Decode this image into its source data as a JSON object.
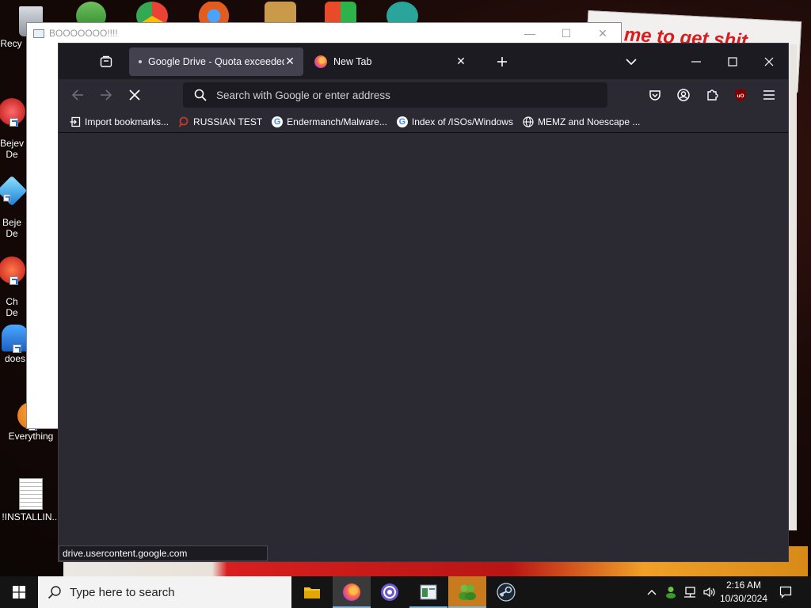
{
  "desktop": {
    "wallpaper_text": "me to get shit",
    "icons": [
      {
        "label": "Recy",
        "name": "recycle-bin"
      },
      {
        "label": "Bejev\nDe",
        "name": "bejeweled-deluxe-1"
      },
      {
        "label": "Beje\nDe",
        "name": "bejeweled-deluxe-2"
      },
      {
        "label": "Ch\nDe",
        "name": "chuzzle-deluxe"
      },
      {
        "label": "does",
        "name": "does-icon"
      },
      {
        "label": "Everything",
        "name": "everything"
      },
      {
        "label": "!INSTALLIN...",
        "name": "installing-file"
      }
    ]
  },
  "bg_window": {
    "title": "BOOOOOOO!!!!"
  },
  "browser": {
    "tabs": [
      {
        "title": "Google Drive - Quota exceeded",
        "active": true,
        "loading": true
      },
      {
        "title": "New Tab",
        "active": false,
        "loading": false
      }
    ],
    "urlbar": {
      "placeholder": "Search with Google or enter address",
      "value": ""
    },
    "bookmarks": [
      {
        "label": "Import bookmarks...",
        "icon": "import-icon"
      },
      {
        "label": "RUSSIAN TEST",
        "icon": "magnifier-icon"
      },
      {
        "label": "Endermanch/Malware...",
        "icon": "google-icon"
      },
      {
        "label": "Index of /ISOs/Windows",
        "icon": "google-icon"
      },
      {
        "label": "MEMZ and Noescape ...",
        "icon": "globe-icon"
      }
    ],
    "status_text": "drive.usercontent.google.com",
    "ublock_badge": "uO"
  },
  "taskbar": {
    "search_placeholder": "Type here to search",
    "apps": [
      "file-explorer",
      "firefox",
      "bittorrent",
      "notepad-app",
      "msn-messenger",
      "steam"
    ],
    "clock_time": "2:16 AM",
    "clock_date": "10/30/2024"
  },
  "colors": {
    "browser_bg": "#2b2a33",
    "tabbar_bg": "#1c1b22",
    "active_tab": "#42414d",
    "taskbar_bg": "#141414"
  }
}
